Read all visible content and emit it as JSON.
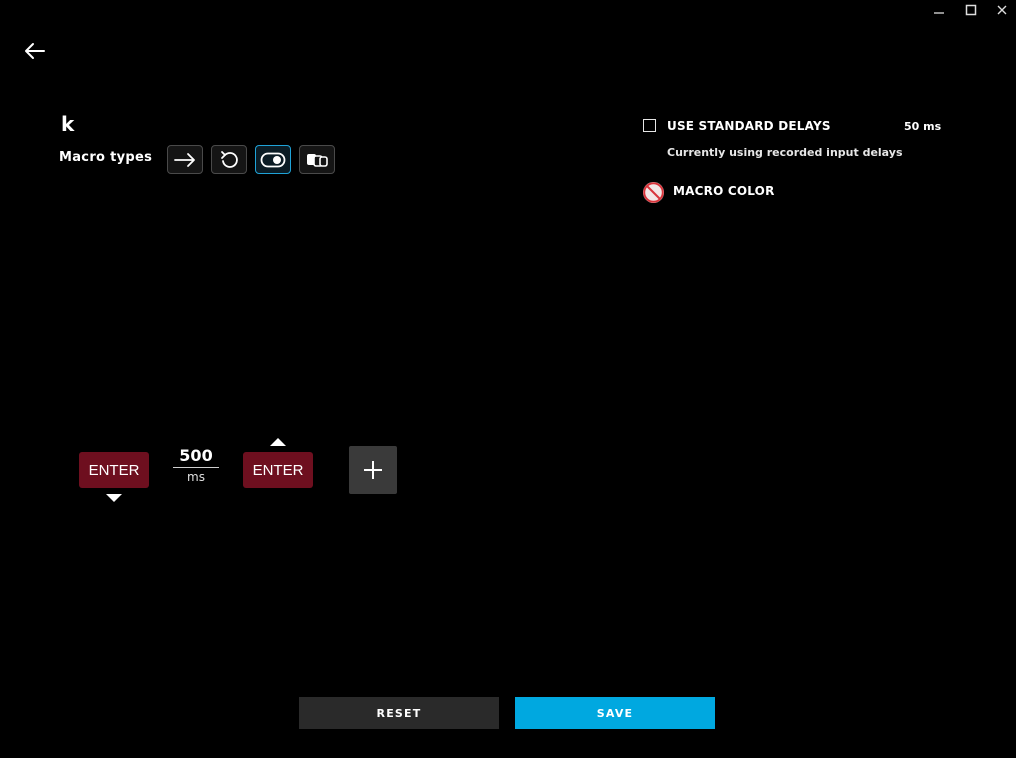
{
  "window_controls": {
    "minimize": "minimize-icon",
    "maximize": "maximize-icon",
    "close": "close-icon"
  },
  "header": {
    "back": "back-arrow-icon",
    "title": "k"
  },
  "macro_types": {
    "label": "Macro types",
    "options": [
      {
        "icon": "arrow-right-icon",
        "active": false
      },
      {
        "icon": "repeat-icon",
        "active": false
      },
      {
        "icon": "toggle-icon",
        "active": true
      },
      {
        "icon": "sequence-icon",
        "active": false
      }
    ]
  },
  "settings": {
    "standard_delays_label": "USE STANDARD DELAYS",
    "standard_delays_checked": false,
    "standard_delay_value": "50 ms",
    "delay_note": "Currently using recorded input delays",
    "macro_color_label": "MACRO COLOR",
    "macro_color_icon": "no-color-icon"
  },
  "sequence": {
    "steps": [
      {
        "label": "ENTER",
        "direction": "down"
      },
      {
        "delay_value": "500",
        "delay_unit": "ms"
      },
      {
        "label": "ENTER",
        "direction": "up"
      }
    ],
    "add_icon": "plus-icon"
  },
  "footer": {
    "reset_label": "RESET",
    "save_label": "SAVE"
  },
  "colors": {
    "background": "#000000",
    "key_fill": "#6e0f1f",
    "accent": "#00a8e0",
    "reset_fill": "#2a2a2a",
    "add_fill": "#3a3a3a"
  }
}
